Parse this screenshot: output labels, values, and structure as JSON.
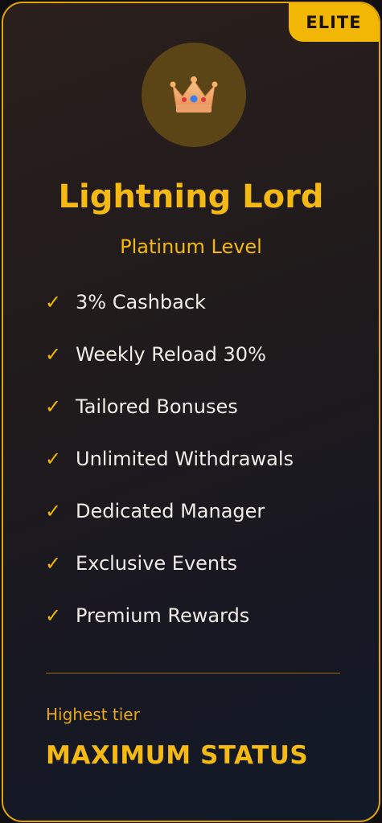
{
  "badge": {
    "label": "ELITE"
  },
  "tier": {
    "icon": "crown-icon",
    "title": "Lightning Lord",
    "level": "Platinum Level"
  },
  "features": [
    {
      "check": "✓",
      "label": "3% Cashback"
    },
    {
      "check": "✓",
      "label": "Weekly Reload 30%"
    },
    {
      "check": "✓",
      "label": "Tailored Bonuses"
    },
    {
      "check": "✓",
      "label": "Unlimited Withdrawals"
    },
    {
      "check": "✓",
      "label": "Dedicated Manager"
    },
    {
      "check": "✓",
      "label": "Exclusive Events"
    },
    {
      "check": "✓",
      "label": "Premium Rewards"
    }
  ],
  "footer": {
    "label": "Highest tier",
    "status": "MAXIMUM STATUS"
  },
  "colors": {
    "accent": "#f2b705",
    "border": "#e3a306",
    "text": "#f0ece6"
  }
}
